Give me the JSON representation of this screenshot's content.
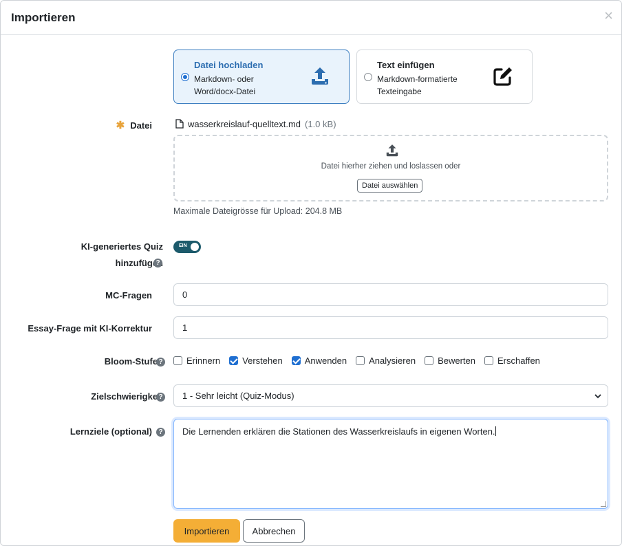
{
  "dialog": {
    "title": "Importieren",
    "close_icon": "×"
  },
  "source": {
    "upload": {
      "title": "Datei hochladen",
      "desc": "Markdown- oder Word/docx-Datei",
      "icon": "upload-icon",
      "selected": true
    },
    "text": {
      "title": "Text einfügen",
      "desc": "Markdown-formatierte Texteingabe",
      "icon": "edit-icon",
      "selected": false
    }
  },
  "file": {
    "label": "Datei",
    "required_mark": "✱",
    "name": "wasserkreislauf-quelltext.md",
    "size": "(1.0 kB)",
    "drop_text": "Datei hierher ziehen und loslassen oder",
    "choose_label": "Datei auswählen",
    "max_size": "Maximale Dateigrösse für Upload: 204.8 MB"
  },
  "quiz": {
    "label_line1": "KI-generiertes Quiz",
    "label_line2": "hinzufügen",
    "toggle_text": "EIN",
    "enabled": true
  },
  "mc": {
    "label": "MC-Fragen",
    "value": "0"
  },
  "essay": {
    "label": "Essay-Frage mit KI-Korrektur",
    "value": "1"
  },
  "bloom": {
    "label": "Bloom-Stufen",
    "levels": [
      {
        "label": "Erinnern",
        "checked": false
      },
      {
        "label": "Verstehen",
        "checked": true
      },
      {
        "label": "Anwenden",
        "checked": true
      },
      {
        "label": "Analysieren",
        "checked": false
      },
      {
        "label": "Bewerten",
        "checked": false
      },
      {
        "label": "Erschaffen",
        "checked": false
      }
    ]
  },
  "difficulty": {
    "label": "Zielschwierigkeit",
    "value": "1 - Sehr leicht (Quiz-Modus)"
  },
  "goals": {
    "label": "Lernziele (optional)",
    "value": "Die Lernenden erklären die Stationen des Wasserkreislaufs in eigenen Worten."
  },
  "actions": {
    "import_label": "Importieren",
    "cancel_label": "Abbrechen"
  },
  "help_glyph": "?",
  "colors": {
    "accent": "#f4ae36",
    "selected_border": "#3d7fc1",
    "toggle_on": "#1c5a6b",
    "checkbox_on": "#1f6fd1"
  }
}
